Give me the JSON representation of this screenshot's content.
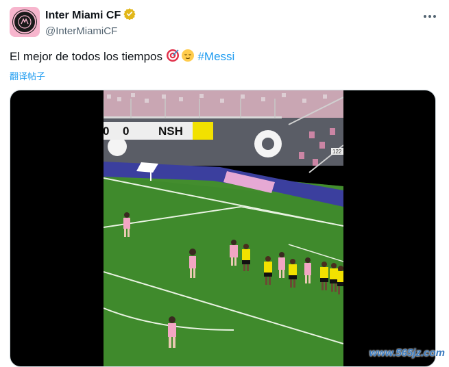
{
  "account": {
    "display_name": "Inter Miami CF",
    "handle": "@InterMiamiCF",
    "verified_icon": "verified-badge-gold"
  },
  "tweet": {
    "text_main": "El mejor de todos los tiempos ",
    "emojis": [
      "target-emoji",
      "relieved-face-emoji"
    ],
    "hashtag": "#Messi",
    "translate_label": "翻译帖子"
  },
  "scoreboard": {
    "home_score": "0",
    "away_score": "0",
    "away_team": "NSH",
    "away_color": "#f2e100"
  },
  "stadium_sign": "122",
  "watermark": "www.565jz.com",
  "colors": {
    "accent": "#1d9bf0",
    "pitch": "#3f8a2c",
    "miami_kit": "#f2a6c4",
    "nashville_kit": "#f2e100"
  }
}
